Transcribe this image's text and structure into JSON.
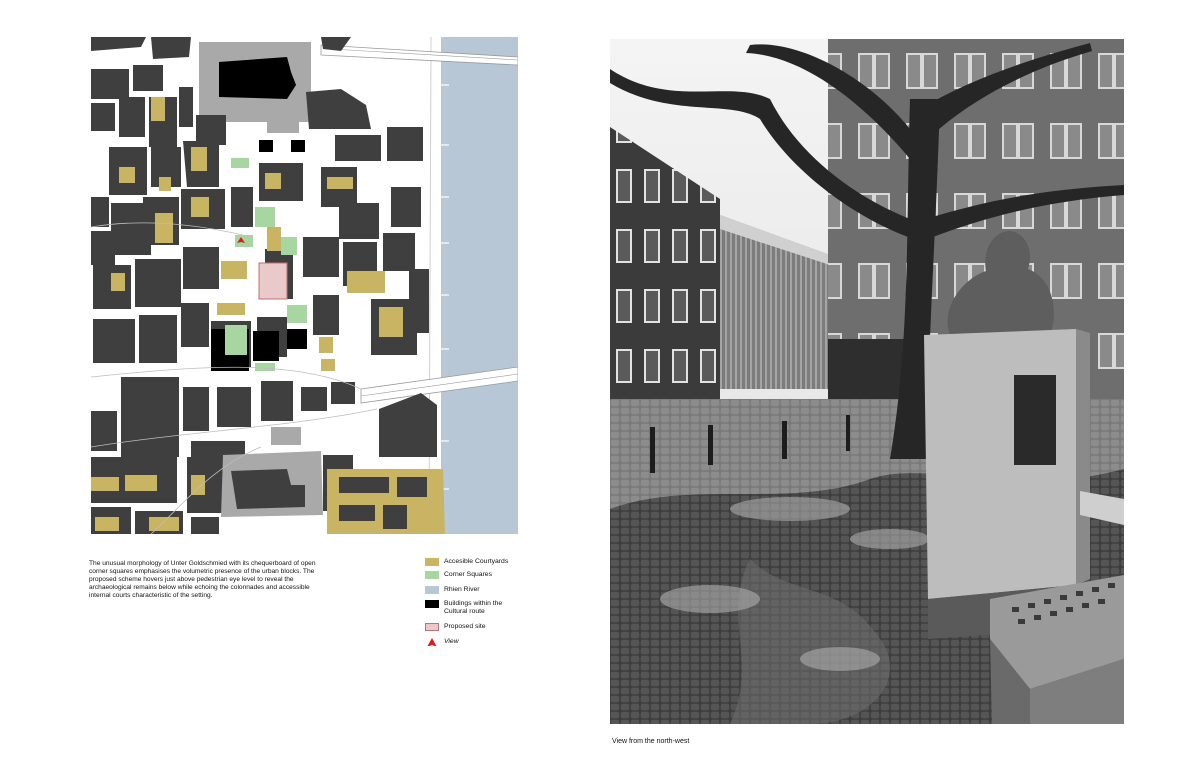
{
  "map": {
    "colors": {
      "building": "#3f3f3f",
      "courtyard": "#c8b462",
      "corner_square": "#a8d6a0",
      "river": "#b8c7d6",
      "cultural_route": "#000000",
      "proposed_site": "#e9c9c9",
      "landmark": "#a9a9a9",
      "view_marker": "#dd1b1b"
    }
  },
  "caption": " The unusual morphology of Unter Goldschmied with its chequerboard of open corner squares emphasises the volumetric presence of the urban blocks. The proposed scheme hovers just above pedestrian eye level to reveal the archaeological remains below while echoing the colonnades and accessible internal courts characteristic of the setting.",
  "legend": [
    {
      "label": "Accesible Courtyards",
      "color": "#c8b462",
      "kind": "swatch"
    },
    {
      "label": "Corner Squares",
      "color": "#a8d6a0",
      "kind": "swatch"
    },
    {
      "label": "Rhien River",
      "color": "#b8c7d6",
      "kind": "swatch"
    },
    {
      "label": "Buildings within the Cultural route",
      "color": "#000000",
      "kind": "swatch"
    },
    {
      "label": "Proposed site",
      "color": "#e9c9c9",
      "kind": "outlined"
    },
    {
      "label": "View",
      "color": "#dd1b1b",
      "kind": "marker"
    }
  ],
  "photo": {
    "caption": "View from the north-west"
  }
}
